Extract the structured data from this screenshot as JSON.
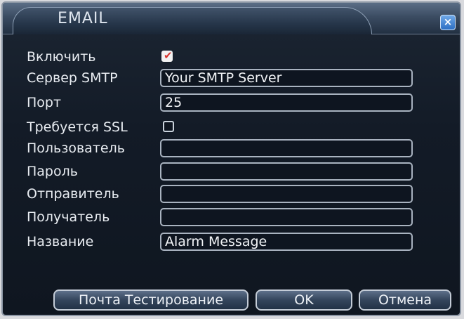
{
  "dialog": {
    "title": "EMAIL",
    "close_glyph": "×",
    "close_icon": "close-icon"
  },
  "form": {
    "enable": {
      "label": "Включить",
      "checked": true
    },
    "smtp_server": {
      "label": "Сервер SMTP",
      "value": "Your SMTP Server"
    },
    "port": {
      "label": "Порт",
      "value": "25"
    },
    "ssl": {
      "label": "Требуется SSL",
      "checked": false
    },
    "user": {
      "label": "Пользователь",
      "value": ""
    },
    "password": {
      "label": "Пароль",
      "value": ""
    },
    "sender": {
      "label": "Отправитель",
      "value": ""
    },
    "recipient": {
      "label": "Получатель",
      "value": ""
    },
    "subject": {
      "label": "Название",
      "value": "Alarm Message"
    }
  },
  "buttons": {
    "test_mail": "Почта Тестирование",
    "ok": "OK",
    "cancel": "Отмена"
  },
  "colors": {
    "checkmark": "#d8352f",
    "close_button": "#2d6fc4"
  }
}
